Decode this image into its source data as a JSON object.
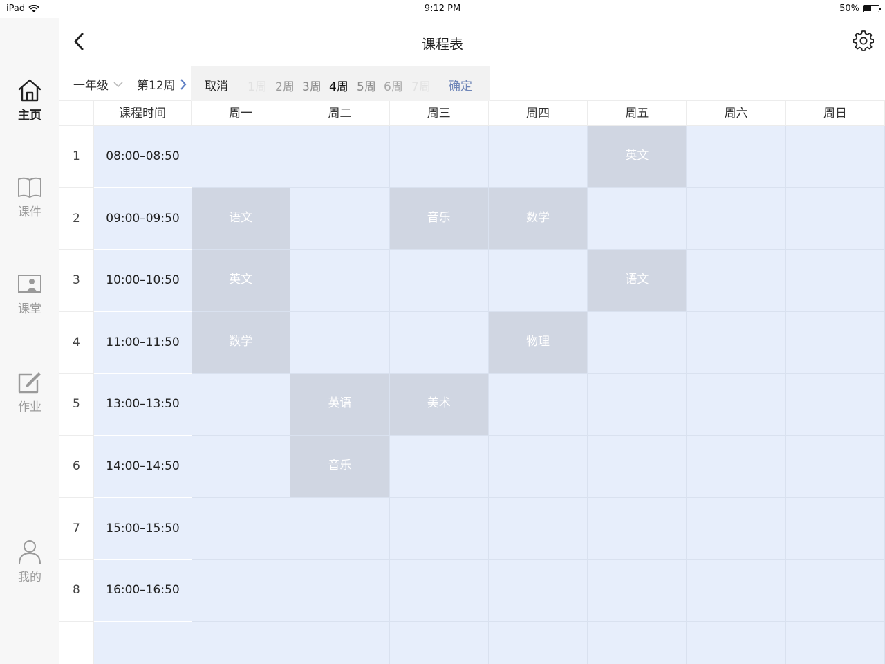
{
  "status_bar": {
    "device": "iPad",
    "time": "9:12 PM",
    "battery": "50%",
    "battery_level": 0.5
  },
  "sidebar": {
    "items": [
      {
        "label": "主页",
        "icon": "home-icon",
        "active": true
      },
      {
        "label": "课件",
        "icon": "book-icon",
        "active": false
      },
      {
        "label": "课堂",
        "icon": "classroom-icon",
        "active": false
      },
      {
        "label": "作业",
        "icon": "edit-icon",
        "active": false
      },
      {
        "label": "我的",
        "icon": "user-icon",
        "active": false
      }
    ]
  },
  "header": {
    "title": "课程表",
    "back_icon": "chevron-left-icon",
    "settings_icon": "gear-icon"
  },
  "toolbar": {
    "grade": "一年级",
    "week": "第12周",
    "cancel": "取消",
    "weeks": [
      {
        "label": "1周",
        "state": "disabled"
      },
      {
        "label": "2周",
        "state": "normal"
      },
      {
        "label": "3周",
        "state": "normal"
      },
      {
        "label": "4周",
        "state": "selected"
      },
      {
        "label": "5周",
        "state": "normal"
      },
      {
        "label": "6周",
        "state": "normal"
      },
      {
        "label": "7周",
        "state": "disabled"
      }
    ],
    "confirm": "确定"
  },
  "timetable": {
    "time_header": "课程时间",
    "days": [
      "周一",
      "周二",
      "周三",
      "周四",
      "周五",
      "周六",
      "周日"
    ],
    "periods": [
      {
        "num": "1",
        "time": "08:00–08:50",
        "courses": [
          "",
          "",
          "",
          "",
          "英文",
          "",
          ""
        ]
      },
      {
        "num": "2",
        "time": "09:00–09:50",
        "courses": [
          "语文",
          "",
          "音乐",
          "数学",
          "",
          "",
          ""
        ]
      },
      {
        "num": "3",
        "time": "10:00–10:50",
        "courses": [
          "英文",
          "",
          "",
          "",
          "语文",
          "",
          ""
        ]
      },
      {
        "num": "4",
        "time": "11:00–11:50",
        "courses": [
          "数学",
          "",
          "",
          "物理",
          "",
          "",
          ""
        ]
      },
      {
        "num": "5",
        "time": "13:00–13:50",
        "courses": [
          "",
          "英语",
          "美术",
          "",
          "",
          "",
          ""
        ]
      },
      {
        "num": "6",
        "time": "14:00–14:50",
        "courses": [
          "",
          "音乐",
          "",
          "",
          "",
          "",
          ""
        ]
      },
      {
        "num": "7",
        "time": "15:00–15:50",
        "courses": [
          "",
          "",
          "",
          "",
          "",
          "",
          ""
        ]
      },
      {
        "num": "8",
        "time": "16:00–16:50",
        "courses": [
          "",
          "",
          "",
          "",
          "",
          "",
          ""
        ]
      },
      {
        "num": "",
        "time": "",
        "courses": [
          "",
          "",
          "",
          "",
          "",
          "",
          ""
        ]
      }
    ]
  },
  "colors": {
    "cell_bg": "#e7eefb",
    "course_bg": "#d0d6e2",
    "accent": "#6f86b8"
  }
}
